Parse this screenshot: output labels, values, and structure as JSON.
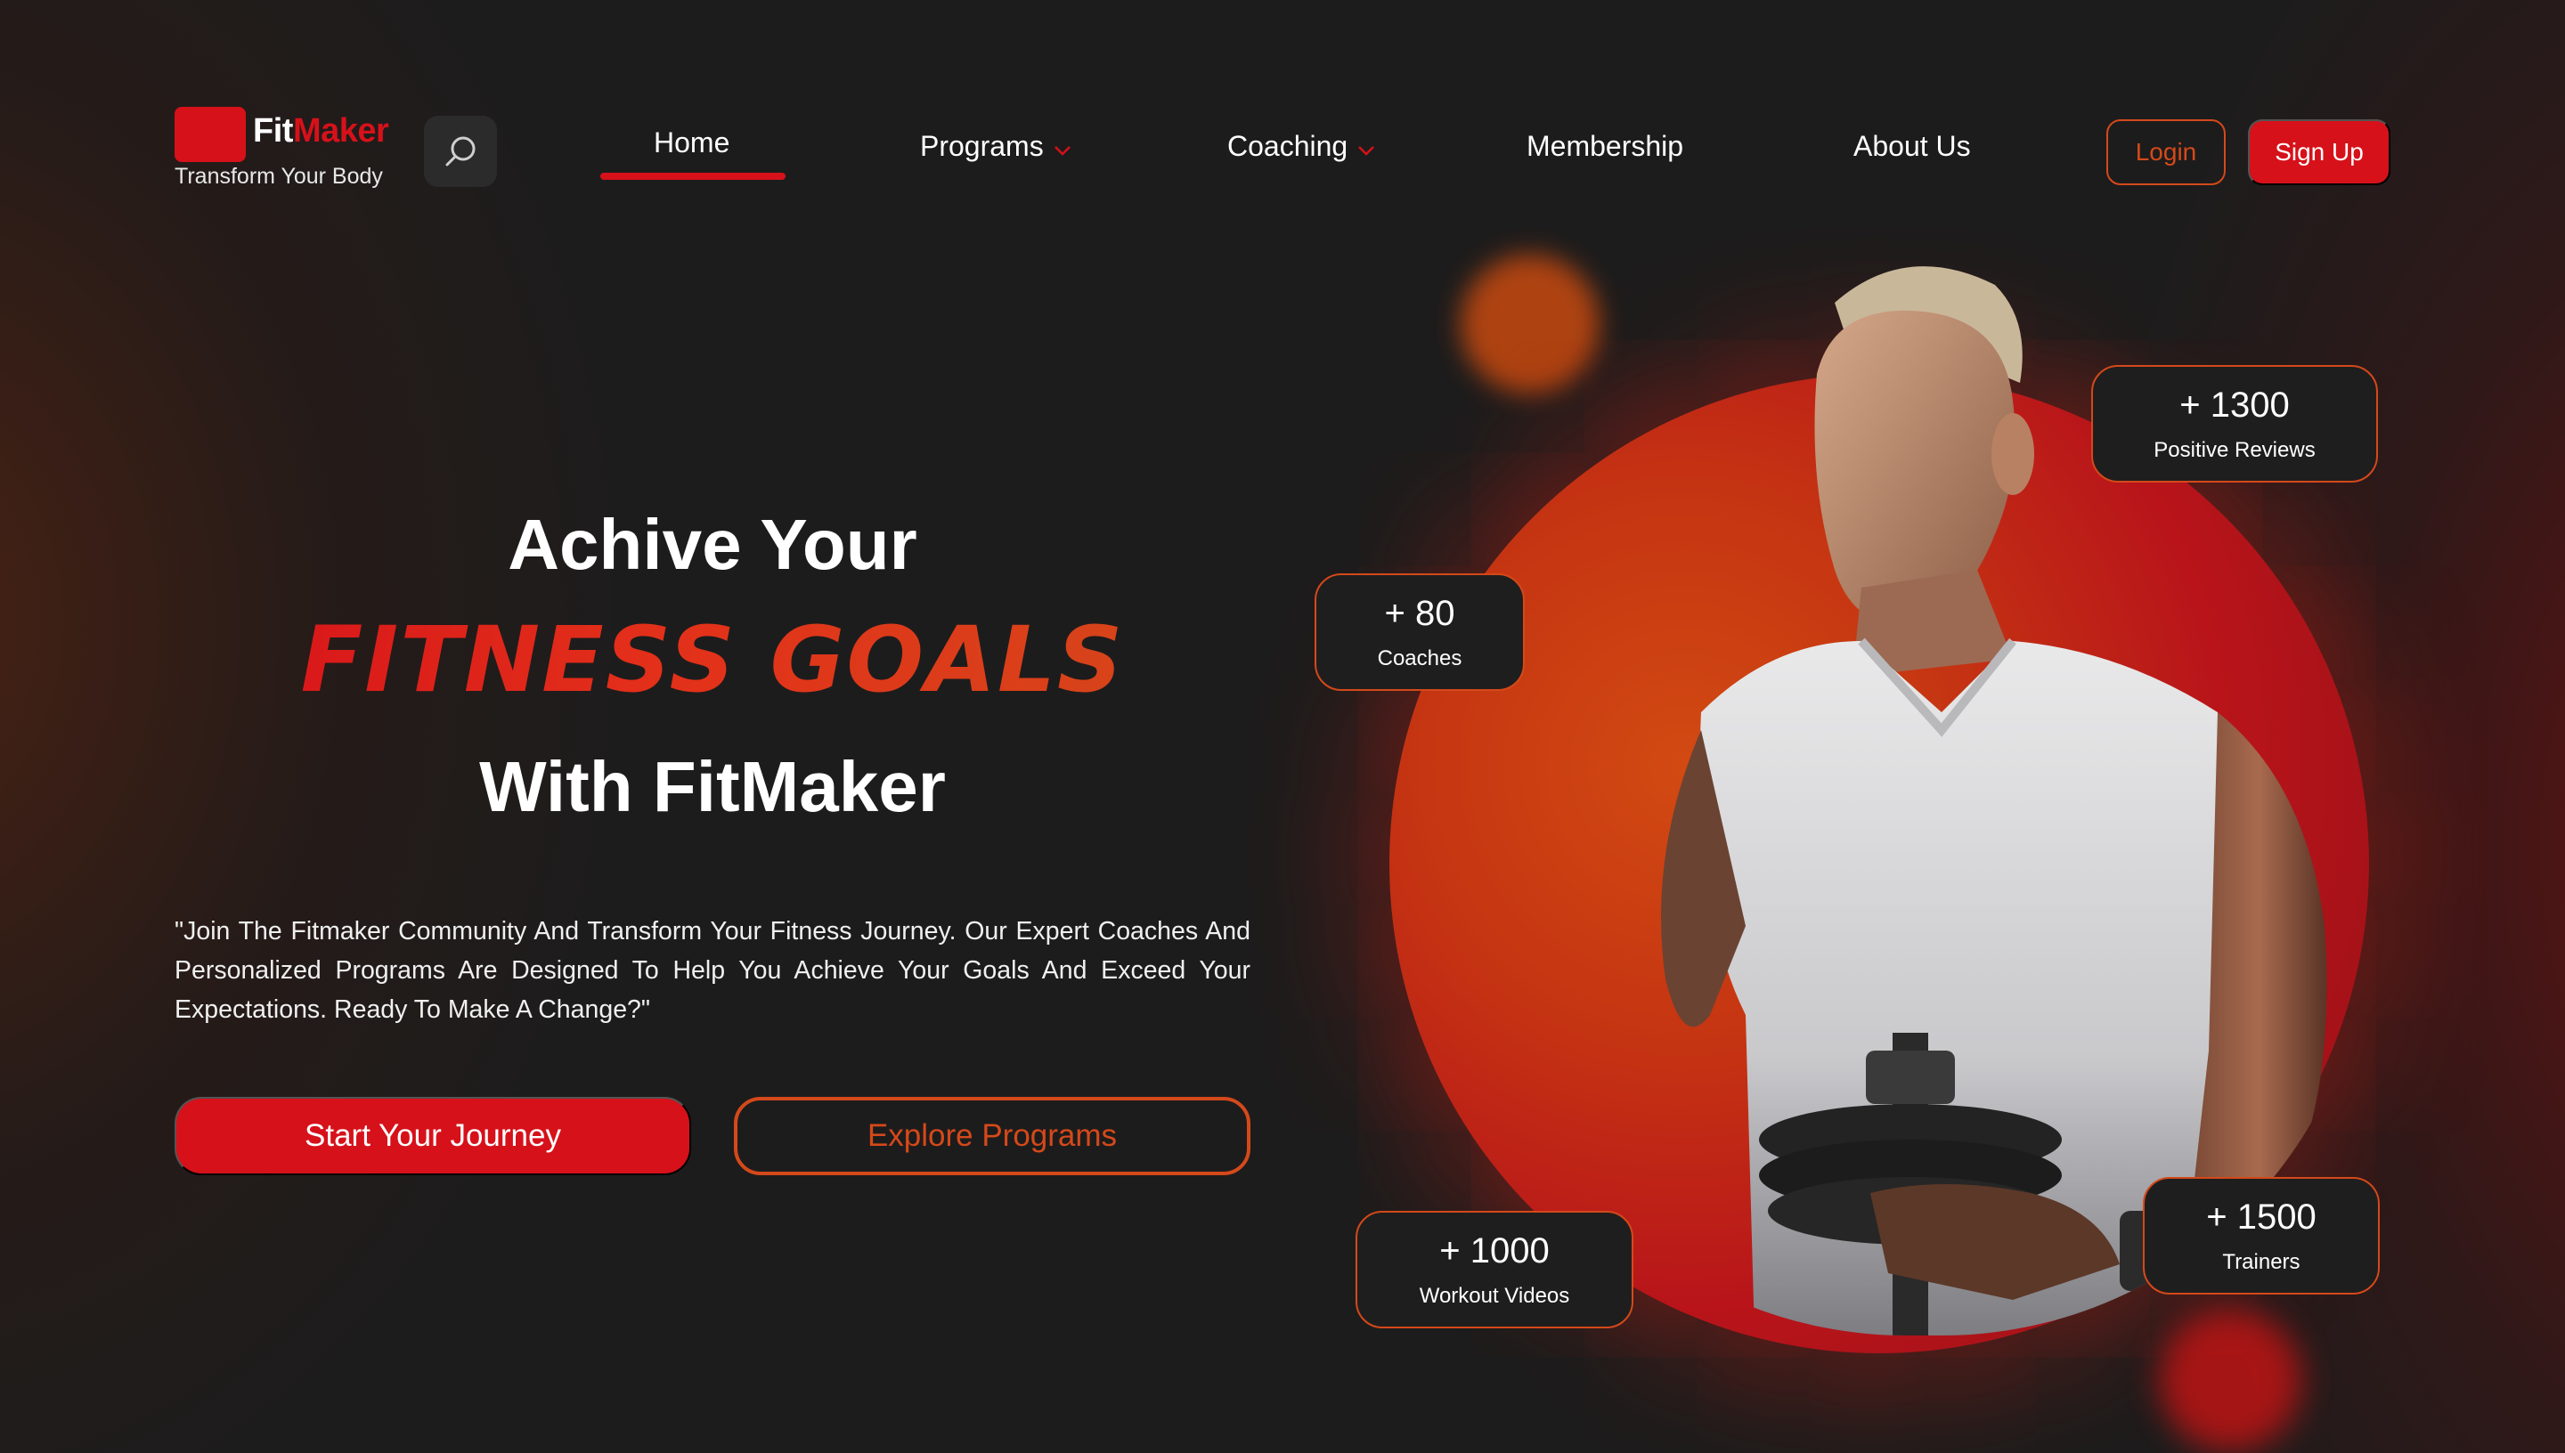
{
  "brand": {
    "name_part1": "Fit",
    "name_part2": "Maker",
    "tagline": "Transform Your Body",
    "primary_color": "#d6111a",
    "accent_color": "#d4491a",
    "background_color": "#1d1c1c"
  },
  "header": {
    "search_icon": "search-icon",
    "nav": [
      {
        "label": "Home",
        "active": true
      },
      {
        "label": "Programs",
        "dropdown": true
      },
      {
        "label": "Coaching",
        "dropdown": true
      },
      {
        "label": "Membership"
      },
      {
        "label": "About Us"
      }
    ],
    "login_label": "Login",
    "signup_label": "Sign Up"
  },
  "hero": {
    "line1": "Achive Your",
    "line2": "FITNESS GOALS",
    "line3": "With FitMaker",
    "description": "\"Join The Fitmaker Community And Transform Your Fitness Journey. Our Expert Coaches And Personalized Programs Are Designed To Help You Achieve Your Goals And Exceed Your Expectations. Ready To Make A Change?\"",
    "primary_cta": "Start Your Journey",
    "secondary_cta": "Explore Programs"
  },
  "stats": {
    "reviews": {
      "value": "+ 1300",
      "label": "Positive Reviews"
    },
    "coaches": {
      "value": "+ 80",
      "label": "Coaches"
    },
    "videos": {
      "value": "+ 1000",
      "label": "Workout Videos"
    },
    "trainers": {
      "value": "+ 1500",
      "label": "Trainers"
    }
  }
}
